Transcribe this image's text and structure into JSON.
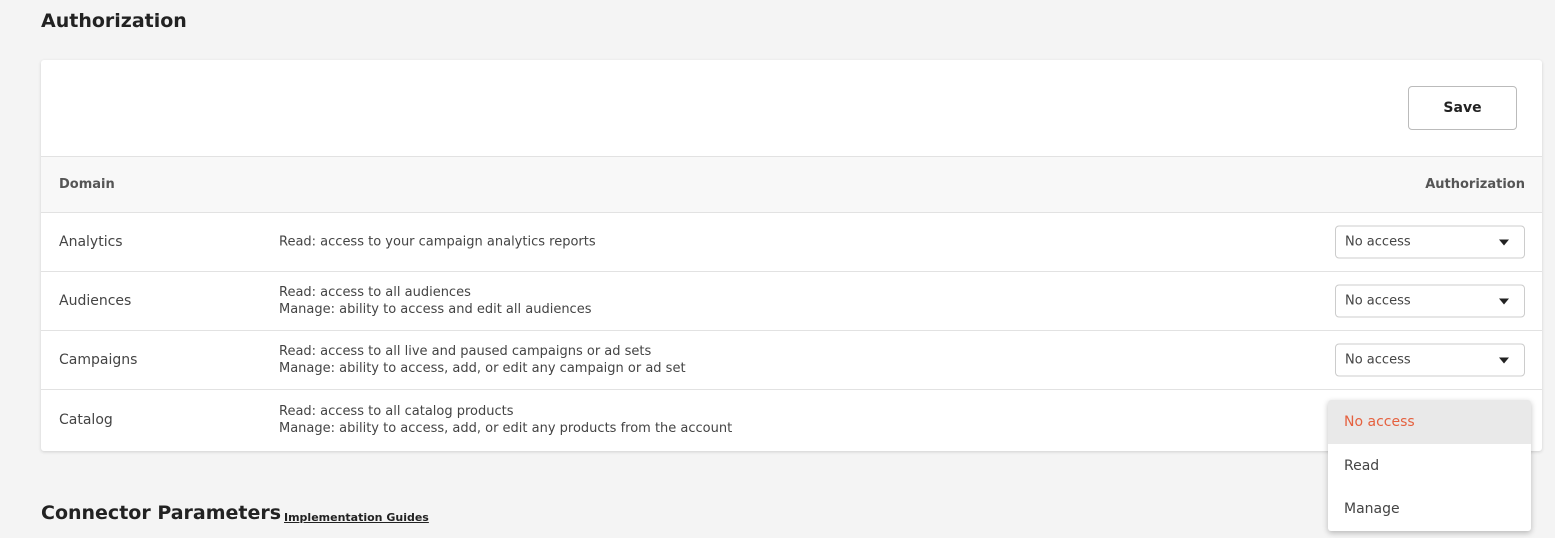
{
  "authorization": {
    "title": "Authorization",
    "save_label": "Save",
    "table": {
      "headers": {
        "domain": "Domain",
        "authorization": "Authorization"
      },
      "rows": [
        {
          "domain": "Analytics",
          "desc_lines": [
            "Read: access to your campaign analytics reports"
          ],
          "value": "No access"
        },
        {
          "domain": "Audiences",
          "desc_lines": [
            "Read: access to all audiences",
            "Manage: ability to access and edit all audiences"
          ],
          "value": "No access"
        },
        {
          "domain": "Campaigns",
          "desc_lines": [
            "Read: access to all live and paused campaigns or ad sets",
            "Manage: ability to access, add, or edit any campaign or ad set"
          ],
          "value": "No access"
        },
        {
          "domain": "Catalog",
          "desc_lines": [
            "Read: access to all catalog products",
            "Manage: ability to access, add, or edit any products from the account"
          ],
          "value": "No access"
        }
      ]
    },
    "dropdown": {
      "options": [
        "No access",
        "Read",
        "Manage"
      ],
      "selected": "No access"
    }
  },
  "connector": {
    "title": "Connector Parameters",
    "guides_link": "Implementation Guides"
  },
  "colors": {
    "accent": "#e5613f",
    "background": "#f4f4f4",
    "card": "#ffffff"
  },
  "icons": {
    "select_caret": "caret-down-icon"
  }
}
